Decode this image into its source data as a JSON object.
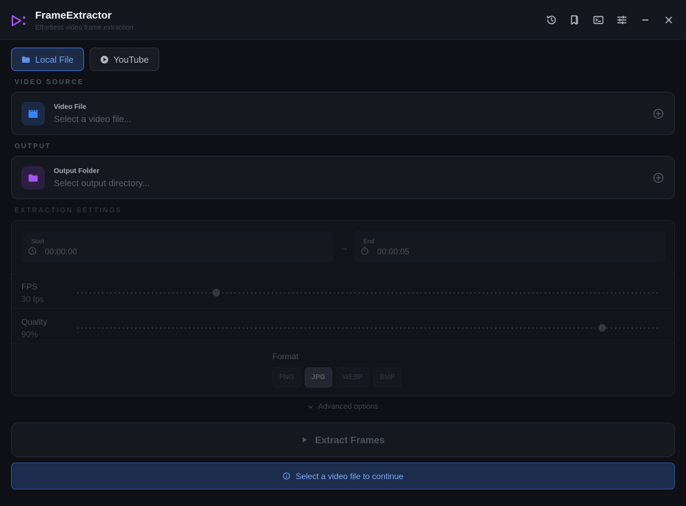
{
  "app": {
    "title": "FrameExtractor",
    "subtitle": "Effortless video frame extraction",
    "accent": "#a855f7"
  },
  "titlebar_buttons": [
    "history-icon",
    "bookmark-icon",
    "terminal-icon",
    "sliders-icon",
    "minimize-icon",
    "close-icon"
  ],
  "tabs": [
    {
      "label": "Local File",
      "icon": "folder-icon",
      "active": true
    },
    {
      "label": "YouTube",
      "icon": "play-circle-icon",
      "active": false
    }
  ],
  "video_source": {
    "section_label": "VIDEO SOURCE",
    "label": "Video File",
    "placeholder": "Select a video file...",
    "icon_color": "#3b82f6"
  },
  "output": {
    "section_label": "OUTPUT",
    "label": "Output Folder",
    "placeholder": "Select output directory...",
    "icon_color": "#a855f7"
  },
  "settings": {
    "section_label": "EXTRACTION SETTINGS",
    "start": {
      "label": "Start",
      "value": "00:00:00"
    },
    "end": {
      "label": "End",
      "value": "00:00:05"
    },
    "arrow": "→",
    "fps": {
      "label": "FPS",
      "value": "30 fps",
      "level": 0.24
    },
    "quality": {
      "label": "Quality",
      "value": "90%",
      "level": 0.9
    },
    "format": {
      "label": "Format",
      "options": [
        "PNG",
        "JPG",
        "WEBP",
        "BMP"
      ],
      "selected": "JPG"
    }
  },
  "advanced_label": "Advanced options",
  "extract_label": "Extract Frames",
  "notice": "Select a video file to continue"
}
